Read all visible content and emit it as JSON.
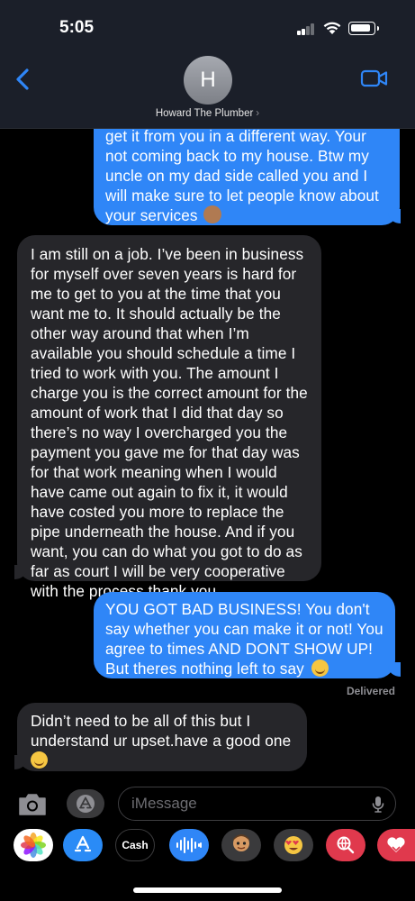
{
  "status_bar": {
    "time": "5:05"
  },
  "contact": {
    "initial": "H",
    "name": "Howard The Plumber",
    "chevron": "›"
  },
  "messages": [
    {
      "direction": "outgoing",
      "text": "get it from you in a different way. Your not coming back to my house. Btw my uncle on my dad side called you and I will make sure to let people know about your services",
      "emoji": "waving-hand-medium-dark-skin"
    },
    {
      "direction": "incoming",
      "text": "I am still on a job. I’ve been in business for myself over seven years is hard for me to get to you at the time that you want me to. It should actually be the other way around that when I’m available you should schedule a time I tried to work with you. The amount I charge you is the correct amount for the amount of work that I did that day so there’s no way I overcharged you the payment you gave me for that day was for that work meaning when I would have came out again to fix it, it would have costed you more to replace the pipe underneath the house. And if you want, you can do what you got to do as far as court I will be very cooperative with the process thank you."
    },
    {
      "direction": "outgoing",
      "text": "YOU GOT BAD BUSINESS! You don't say whether you can make it or not! You agree to times AND DONT SHOW UP! But theres nothing left to say",
      "emoji": "smiling-face-with-halo"
    },
    {
      "direction": "incoming",
      "text": "Didn’t need to be all of this but I understand ur upset.have a good one",
      "emoji": "smiling-face-with-smiling-eyes"
    }
  ],
  "delivered_label": "Delivered",
  "input": {
    "placeholder": "iMessage",
    "value": ""
  },
  "app_drawer": [
    {
      "name": "photos",
      "label": ""
    },
    {
      "name": "app-store",
      "label": ""
    },
    {
      "name": "apple-cash",
      "label": "Cash"
    },
    {
      "name": "audio-message",
      "label": ""
    },
    {
      "name": "memoji",
      "label": ""
    },
    {
      "name": "memoji-stickers",
      "label": ""
    },
    {
      "name": "images-search",
      "label": ""
    },
    {
      "name": "digital-touch",
      "label": ""
    }
  ],
  "colors": {
    "outgoing_bubble": "#2f86f7",
    "incoming_bubble": "#26262a",
    "accent": "#2f86f7",
    "background": "#000000",
    "header": "#1b1f29"
  }
}
